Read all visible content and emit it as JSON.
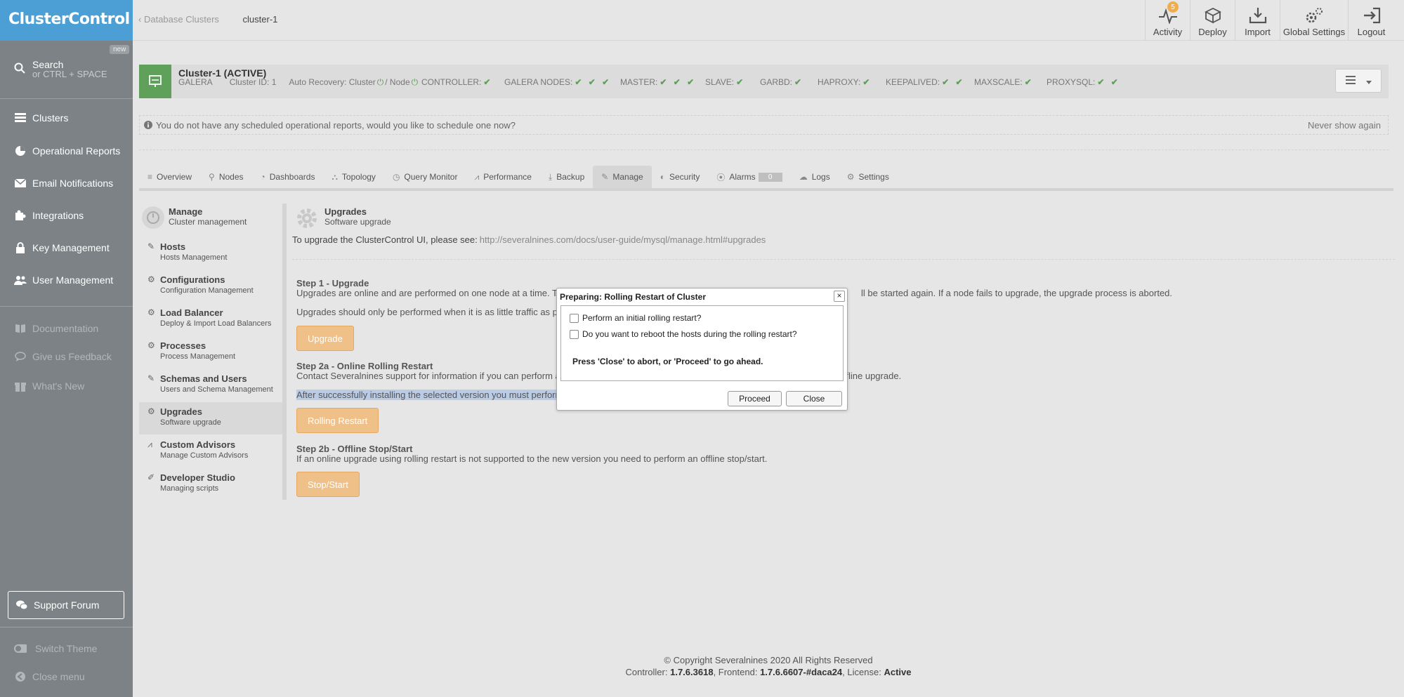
{
  "sidebar": {
    "logo": "ClusterControl",
    "new_badge": "new",
    "search_label": "Search",
    "search_hint": "or CTRL + SPACE",
    "items": [
      {
        "label": "Clusters",
        "icon": "server-icon"
      },
      {
        "label": "Operational Reports",
        "icon": "pie-chart-icon"
      },
      {
        "label": "Email Notifications",
        "icon": "envelope-icon"
      },
      {
        "label": "Integrations",
        "icon": "puzzle-icon"
      },
      {
        "label": "Key Management",
        "icon": "lock-icon"
      },
      {
        "label": "User Management",
        "icon": "users-icon"
      }
    ],
    "secondary": [
      {
        "label": "Documentation",
        "icon": "book-icon"
      },
      {
        "label": "Give us Feedback",
        "icon": "comment-icon"
      },
      {
        "label": "What's New",
        "icon": "gift-icon"
      }
    ],
    "support": "Support Forum",
    "switch_theme": "Switch Theme",
    "close_menu": "Close menu"
  },
  "topbar": {
    "breadcrumb_parent": "Database Clusters",
    "breadcrumb_current": "cluster-1",
    "activity": "Activity",
    "activity_count": "5",
    "deploy": "Deploy",
    "import": "Import",
    "global_settings": "Global Settings",
    "logout": "Logout"
  },
  "cluster": {
    "name": "Cluster-1 (ACTIVE)",
    "type": "GALERA",
    "cluster_id": "Cluster ID: 1",
    "auto_recovery": "Auto Recovery: Cluster",
    "node_label": "/ Node",
    "stats": [
      {
        "label": "CONTROLLER:",
        "checks": "✔"
      },
      {
        "label": "GALERA NODES:",
        "checks": "✔ ✔ ✔"
      },
      {
        "label": "MASTER:",
        "checks": "✔ ✔ ✔"
      },
      {
        "label": "SLAVE:",
        "checks": "✔"
      },
      {
        "label": "GARBD:",
        "checks": "✔"
      },
      {
        "label": "HAPROXY:",
        "checks": "✔"
      },
      {
        "label": "KEEPALIVED:",
        "checks": "✔ ✔"
      },
      {
        "label": "MAXSCALE:",
        "checks": "✔"
      },
      {
        "label": "PROXYSQL:",
        "checks": "✔ ✔"
      }
    ]
  },
  "notice": {
    "text": "You do not have any scheduled operational reports, would you like to schedule one now?",
    "dismiss": "Never show again"
  },
  "tabs": [
    {
      "label": "Overview",
      "icon": "≡"
    },
    {
      "label": "Nodes",
      "icon": "⚲"
    },
    {
      "label": "Dashboards",
      "icon": "◔"
    },
    {
      "label": "Topology",
      "icon": "⛬"
    },
    {
      "label": "Query Monitor",
      "icon": "◷"
    },
    {
      "label": "Performance",
      "icon": "⩘"
    },
    {
      "label": "Backup",
      "icon": "⤓"
    },
    {
      "label": "Manage",
      "icon": "✎"
    },
    {
      "label": "Security",
      "icon": "◐"
    },
    {
      "label": "Alarms",
      "icon": "⦿"
    },
    {
      "label": "Logs",
      "icon": "☁"
    },
    {
      "label": "Settings",
      "icon": "⚙"
    }
  ],
  "alarm_count": "0",
  "manage_menu": {
    "title": "Manage",
    "subtitle": "Cluster management",
    "items": [
      {
        "label": "Hosts",
        "sub": "Hosts Management",
        "icon": "✎"
      },
      {
        "label": "Configurations",
        "sub": "Configuration Management",
        "icon": "⚙"
      },
      {
        "label": "Load Balancer",
        "sub": "Deploy & Import Load Balancers",
        "icon": "⚙"
      },
      {
        "label": "Processes",
        "sub": "Process Management",
        "icon": "⚙"
      },
      {
        "label": "Schemas and Users",
        "sub": "Users and Schema Management",
        "icon": "✎"
      },
      {
        "label": "Upgrades",
        "sub": "Software upgrade",
        "icon": "⚙"
      },
      {
        "label": "Custom Advisors",
        "sub": "Manage Custom Advisors",
        "icon": "⩘"
      },
      {
        "label": "Developer Studio",
        "sub": "Managing scripts",
        "icon": "✐"
      }
    ]
  },
  "upgrades": {
    "title": "Upgrades",
    "subtitle": "Software upgrade",
    "ui_note": "To upgrade the ClusterControl UI, please see:",
    "ui_link": "http://severalnines.com/docs/user-guide/mysql/manage.html#upgrades",
    "step1_title": "Step 1 - Upgrade",
    "step1_text_a": "Upgrades are online and are performed on one node at a time. The",
    "step1_text_b": "ll be started again. If a node fails to upgrade, the upgrade process is aborted.",
    "step1_text2": "Upgrades should only be performed when it is as little traffic as po",
    "upgrade_btn": "Upgrade",
    "step2a_title": "Step 2a - Online Rolling Restart",
    "step2a_text_a": "Contact Severalnines support for information if you can perform an",
    "step2a_text_b": "ffline upgrade.",
    "step2a_selected": "After successfully installing the selected version you must perform",
    "rolling_btn": "Rolling Restart",
    "step2b_title": "Step 2b - Offline Stop/Start",
    "step2b_text": "If an online upgrade using rolling restart is not supported to the new version you need to perform an offline stop/start.",
    "stopstart_btn": "Stop/Start"
  },
  "modal": {
    "title": "Preparing: Rolling Restart of Cluster",
    "close_x": "×",
    "option1": "Perform an initial rolling restart?",
    "option2": "Do you want to reboot the hosts during the rolling restart?",
    "note": "Press 'Close' to abort, or 'Proceed' to go ahead.",
    "proceed": "Proceed",
    "close": "Close"
  },
  "footer": {
    "copyright": "© Copyright Severalnines 2020 All Rights Reserved",
    "controller_label": "Controller:",
    "controller_version": "1.7.6.3618",
    "frontend_label": ", Frontend:",
    "frontend_version": "1.7.6.6607-#daca24",
    "license_label": ", License:",
    "license_value": "Active"
  },
  "colors": {
    "logo_bg": "#4b9fd5",
    "sidebar_bg": "#7c8285",
    "cluster_green": "#5fa05a",
    "button_orange": "#f0c089",
    "badge_orange": "#f0ad4e"
  }
}
